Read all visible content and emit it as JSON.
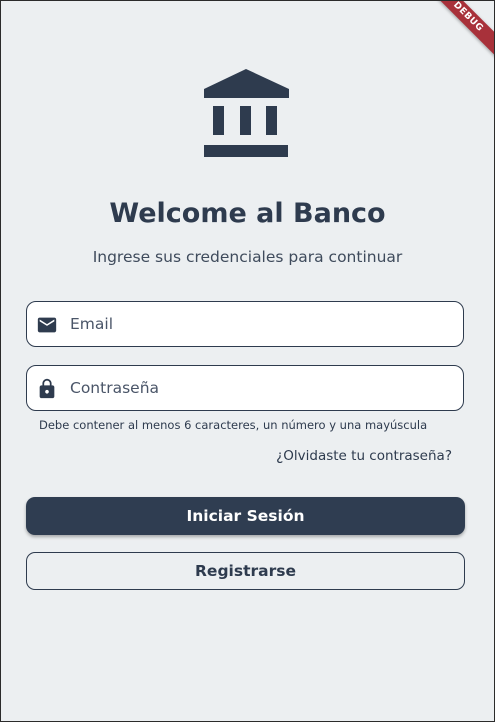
{
  "debug_banner": "DEBUG",
  "logo": {
    "icon": "bank-icon",
    "color": "#2e3b4e"
  },
  "header": {
    "title": "Welcome al Banco",
    "subtitle": "Ingrese sus credenciales para continuar"
  },
  "form": {
    "email": {
      "icon": "email-icon",
      "value": "",
      "placeholder": "Email"
    },
    "password": {
      "icon": "lock-icon",
      "value": "",
      "placeholder": "Contraseña"
    },
    "password_helper": "Debe contener al menos 6 caracteres, un número y una mayúscula",
    "forgot_link": "¿Olvidaste tu contraseña?"
  },
  "actions": {
    "login_label": "Iniciar Sesión",
    "register_label": "Registrarse"
  },
  "colors": {
    "primary": "#2f3d51",
    "background": "#eceff1",
    "debug_ribbon": "#a8313a"
  }
}
